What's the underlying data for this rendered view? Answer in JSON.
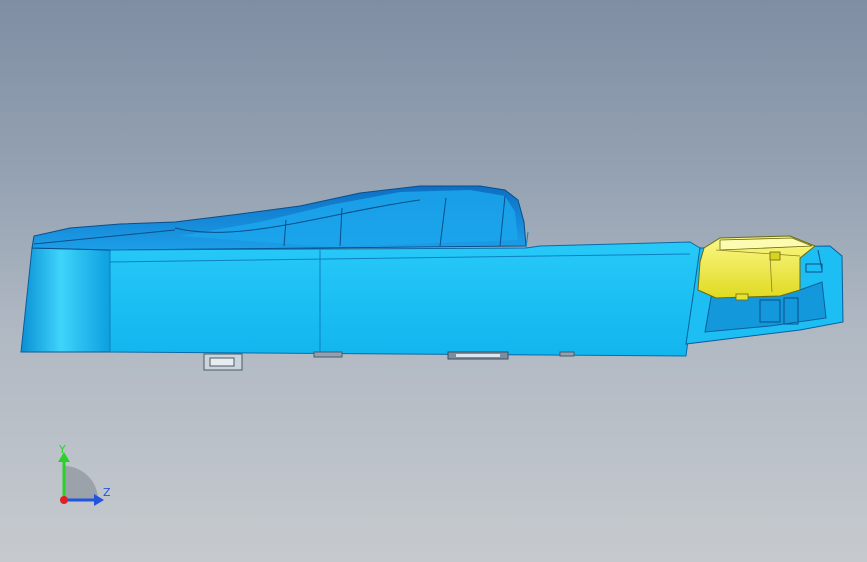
{
  "viewport": {
    "background_top": "#7f8ea3",
    "background_bottom": "#c6cace"
  },
  "model": {
    "body_color": "#19c3f5",
    "component_color": "#f2ef4a"
  },
  "triad": {
    "y_label": "Y",
    "z_label": "Z",
    "y_color": "#2bd12b",
    "z_color": "#2255dd",
    "x_color": "#e02020"
  }
}
